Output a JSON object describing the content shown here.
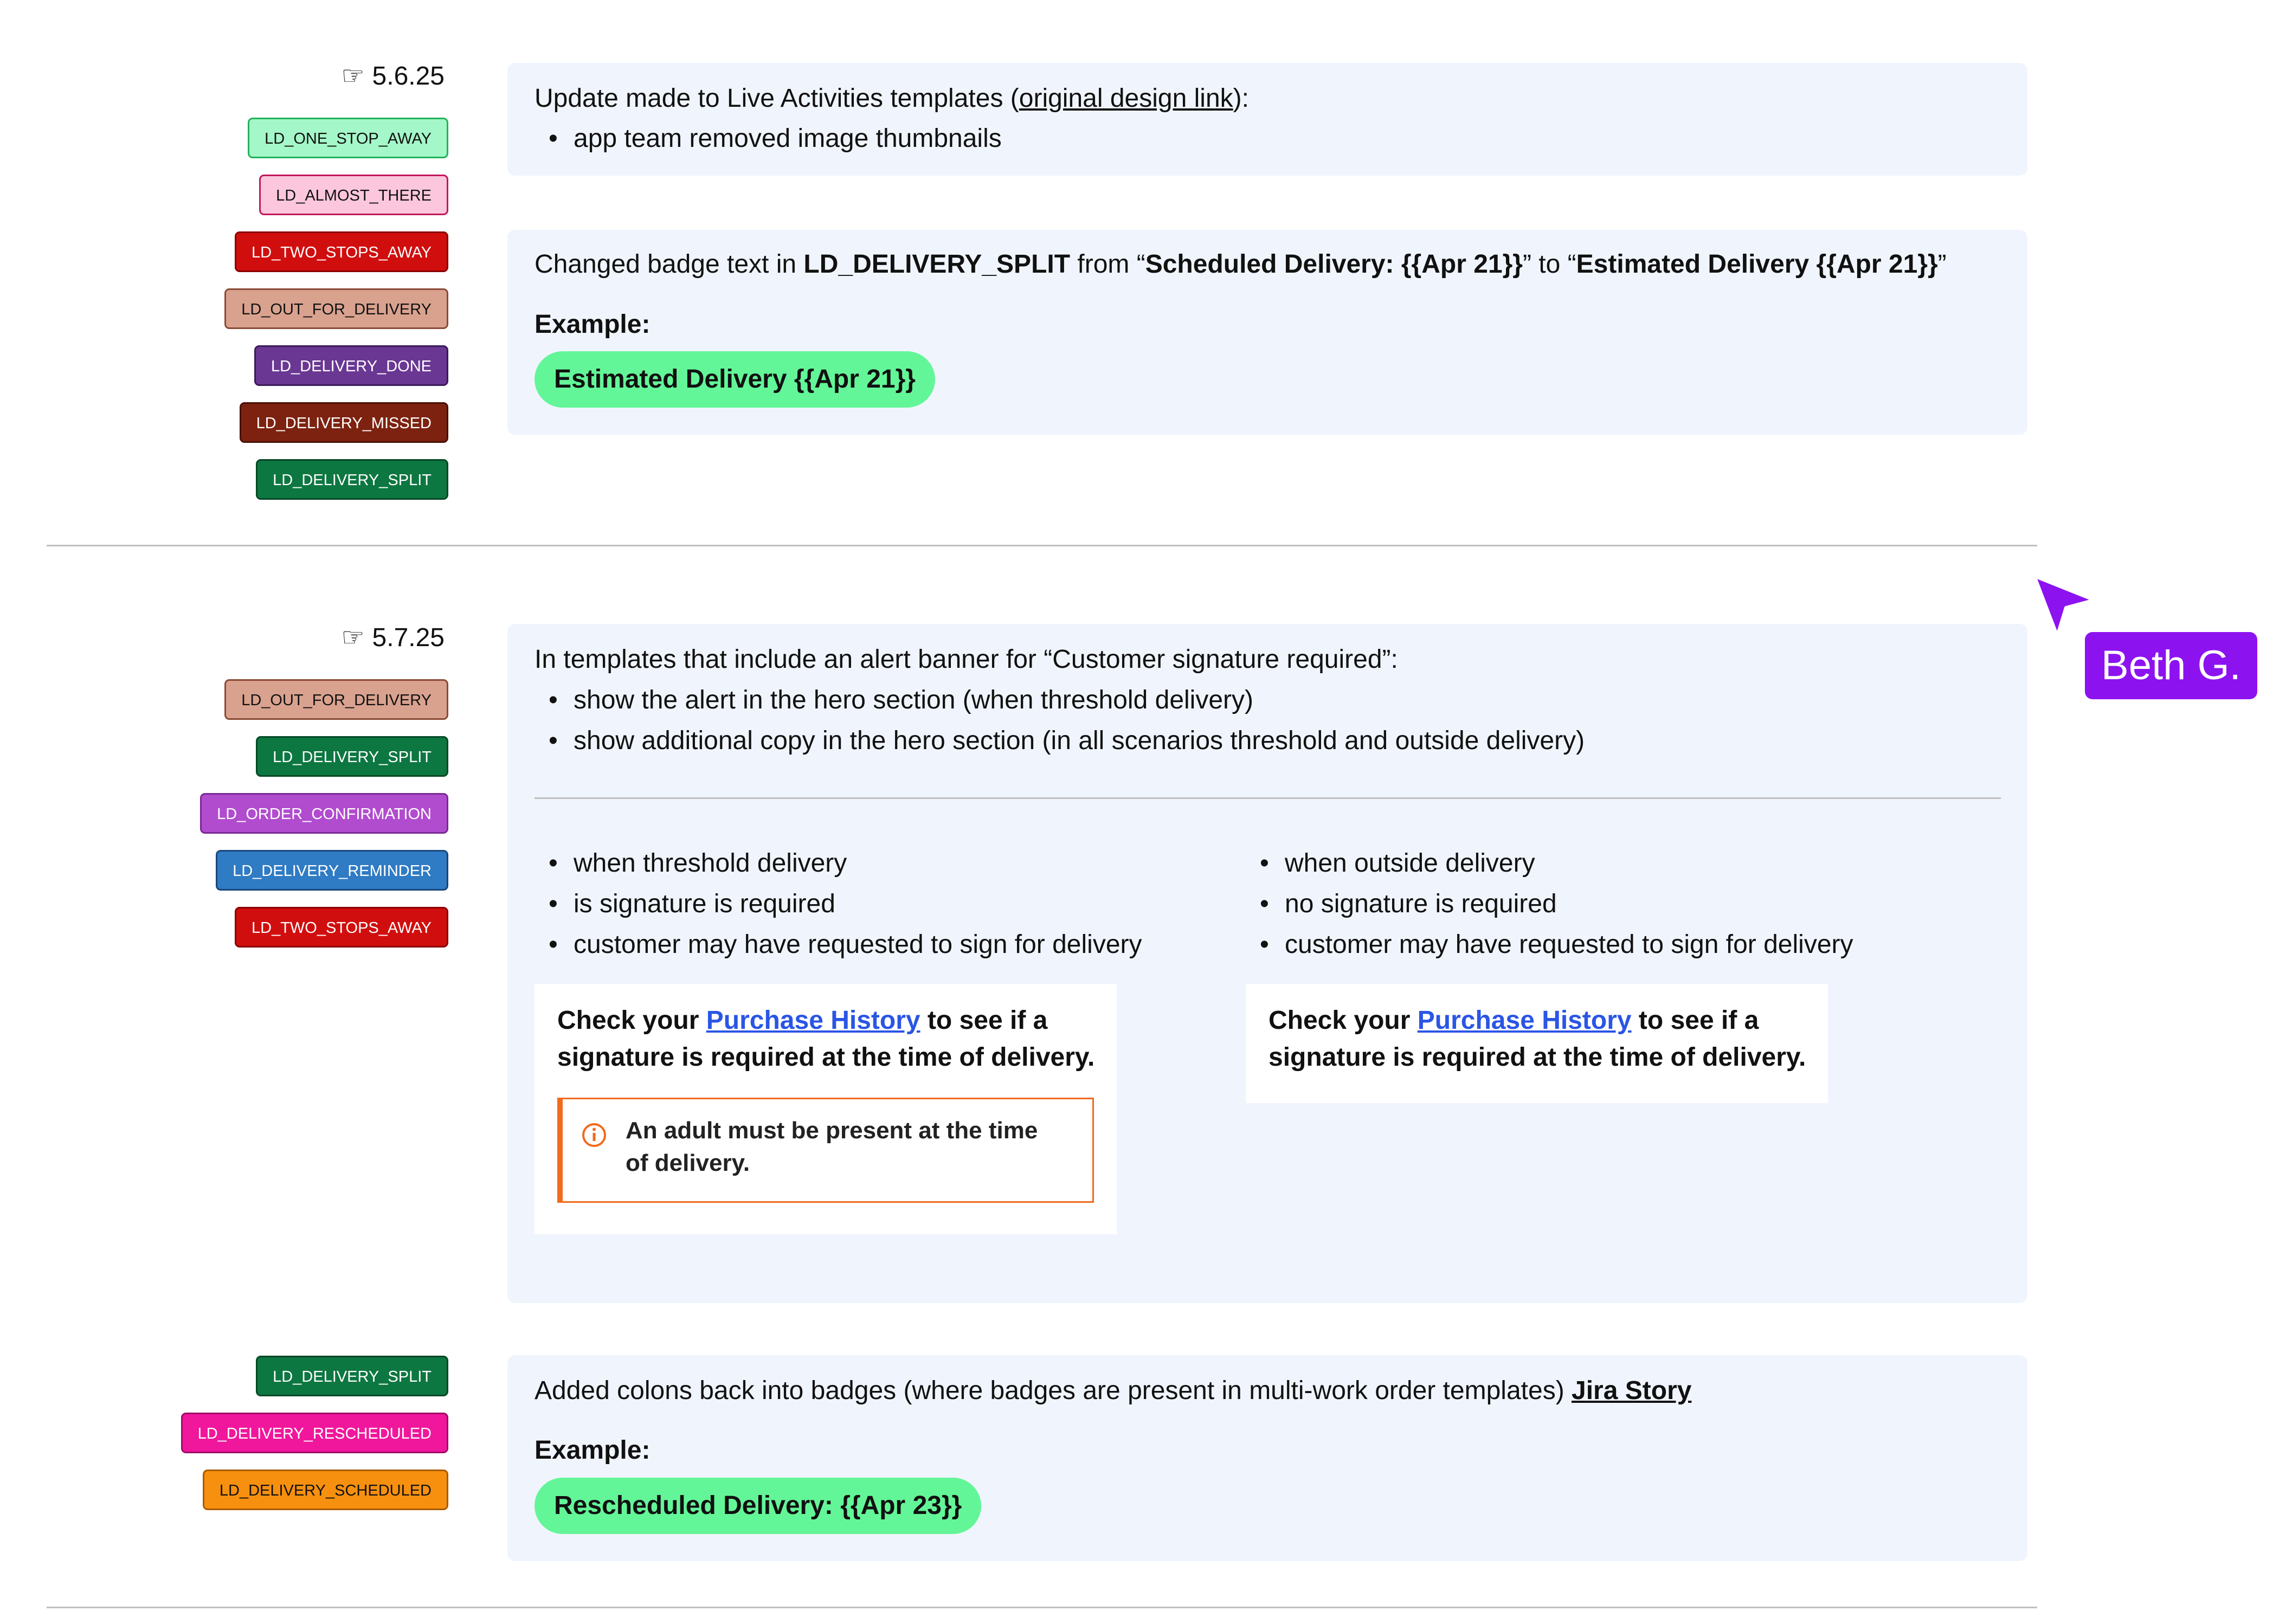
{
  "section1": {
    "date": "5.6.25",
    "hand": "☞",
    "tags": [
      {
        "label": "LD_ONE_STOP_AWAY",
        "bg": "#a4f7c8",
        "border": "#22b35a",
        "color": "#111"
      },
      {
        "label": "LD_ALMOST_THERE",
        "bg": "#fcc7dc",
        "border": "#c2185b",
        "color": "#111"
      },
      {
        "label": "LD_TWO_STOPS_AWAY",
        "bg": "#d10e0e",
        "border": "#8a0000",
        "color": "#fff"
      },
      {
        "label": "LD_OUT_FOR_DELIVERY",
        "bg": "#d9a28f",
        "border": "#8a4a35",
        "color": "#111"
      },
      {
        "label": "LD_DELIVERY_DONE",
        "bg": "#6a3793",
        "border": "#3b1a58",
        "color": "#fff"
      },
      {
        "label": "LD_DELIVERY_MISSED",
        "bg": "#7d2210",
        "border": "#4a1006",
        "color": "#fff"
      },
      {
        "label": "LD_DELIVERY_SPLIT",
        "bg": "#0d7741",
        "border": "#064826",
        "color": "#fff"
      }
    ],
    "card1": {
      "text_pre": "Update made to Live Activities templates (",
      "link": "original design link",
      "text_post": "):",
      "bullet": "app team removed image thumbnails"
    },
    "card2": {
      "p1": "Changed badge text in ",
      "b1": "LD_DELIVERY_SPLIT",
      "p2": " from “",
      "b2": "Scheduled Delivery: {{Apr 21}}",
      "p3": "” to “",
      "b3": "Estimated Delivery {{Apr 21}}",
      "p4": "”",
      "example": "Example:",
      "badge": "Estimated Delivery {{Apr 21}}"
    }
  },
  "section2": {
    "date": "5.7.25",
    "hand": "☞",
    "tags": [
      {
        "label": "LD_OUT_FOR_DELIVERY",
        "bg": "#d9a28f",
        "border": "#8a4a35",
        "color": "#111"
      },
      {
        "label": "LD_DELIVERY_SPLIT",
        "bg": "#0d7741",
        "border": "#064826",
        "color": "#fff"
      },
      {
        "label": "LD_ORDER_CONFIRMATION",
        "bg": "#b14ccf",
        "border": "#7a2a94",
        "color": "#fff"
      },
      {
        "label": "LD_DELIVERY_REMINDER",
        "bg": "#2f7bc4",
        "border": "#17477a",
        "color": "#fff"
      },
      {
        "label": "LD_TWO_STOPS_AWAY",
        "bg": "#d10e0e",
        "border": "#8a0000",
        "color": "#fff"
      }
    ],
    "card": {
      "intro": "In templates that include an alert banner for “Customer signature required”:",
      "bullets": [
        "show the alert in the hero section (when threshold delivery)",
        "show additional copy in the hero section (in all scenarios threshold and outside delivery)"
      ],
      "left_bullets": [
        "when threshold delivery",
        "is signature is required",
        "customer may have requested to sign for delivery"
      ],
      "right_bullets": [
        "when outside delivery",
        "no signature is required",
        "customer may have requested to sign for delivery"
      ],
      "check_pre": "Check your ",
      "check_link": "Purchase History",
      "check_post": " to see if a",
      "check_line2": "signature is required at the time of delivery.",
      "alert_line1": "An adult must be present at the time",
      "alert_line2": "of delivery."
    }
  },
  "section3": {
    "tags": [
      {
        "label": "LD_DELIVERY_SPLIT",
        "bg": "#0d7741",
        "border": "#064826",
        "color": "#fff"
      },
      {
        "label": "LD_DELIVERY_RESCHEDULED",
        "bg": "#f0179c",
        "border": "#a10b67",
        "color": "#fff"
      },
      {
        "label": "LD_DELIVERY_SCHEDULED",
        "bg": "#f7900f",
        "border": "#a85c00",
        "color": "#111"
      }
    ],
    "card": {
      "text": "Added colons back into badges (where badges are present in multi-work order templates) ",
      "link": "Jira Story",
      "example": "Example:",
      "badge": "Rescheduled Delivery: {{Apr 23}}"
    }
  },
  "cursor": {
    "label": "Beth G.",
    "color": "#8d12f0"
  }
}
